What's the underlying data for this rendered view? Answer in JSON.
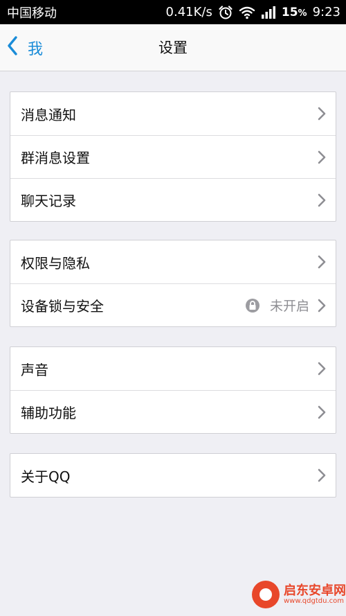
{
  "status_bar": {
    "carrier": "中国移动",
    "net_speed": "0.41K/s",
    "battery_value": "15",
    "battery_unit": "%",
    "time": "9:23"
  },
  "nav": {
    "back_label": "我",
    "title": "设置"
  },
  "groups": [
    {
      "items": [
        {
          "label": "消息通知"
        },
        {
          "label": "群消息设置"
        },
        {
          "label": "聊天记录"
        }
      ]
    },
    {
      "items": [
        {
          "label": "权限与隐私"
        },
        {
          "label": "设备锁与安全",
          "value": "未开启"
        }
      ]
    },
    {
      "items": [
        {
          "label": "声音"
        },
        {
          "label": "辅助功能"
        }
      ]
    },
    {
      "items": [
        {
          "label": "关于QQ"
        }
      ]
    }
  ],
  "watermark": {
    "title": "启东安卓网",
    "url": "www.qdgtdu.com"
  },
  "colors": {
    "accent": "#1a8cd8",
    "background": "#efeff4",
    "secondary_text": "#8e8e93",
    "watermark": "#e8472a"
  },
  "icons": [
    "back-chevron-icon",
    "alarm-clock-icon",
    "wifi-icon",
    "signal-bars-icon",
    "lock-icon",
    "chevron-right-icon"
  ]
}
